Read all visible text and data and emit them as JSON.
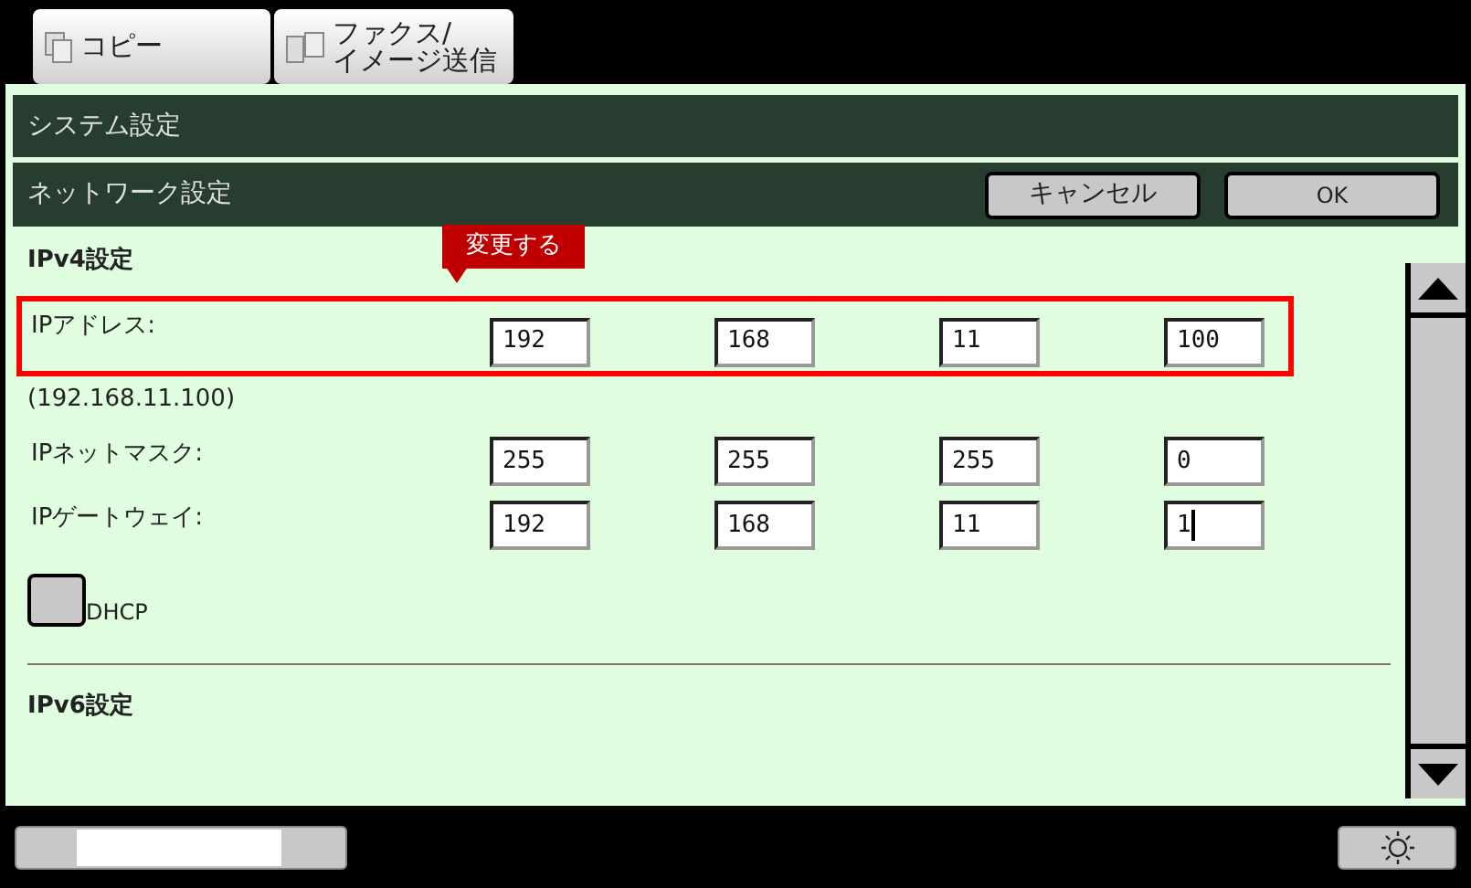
{
  "top_tabs": [
    {
      "label": "コピー",
      "kind": "copy"
    },
    {
      "label": "ファクス/\nイメージ送信",
      "kind": "fax"
    }
  ],
  "title": "システム設定",
  "subtitle": "ネットワーク設定",
  "buttons": [
    "キャンセル",
    "OK"
  ],
  "sections": [
    {
      "kind": "heading",
      "text": "IPv4設定"
    },
    {
      "kind": "address",
      "label": "IPアドレス:",
      "highlighted": true,
      "callout": "変更する",
      "octets": [
        {
          "value": "192",
          "cursor": false
        },
        {
          "value": "168",
          "cursor": false
        },
        {
          "value": "11",
          "cursor": false
        },
        {
          "value": "100",
          "cursor": false
        }
      ]
    },
    {
      "kind": "note",
      "text": "(192.168.11.100)"
    },
    {
      "kind": "address",
      "label": "IPネットマスク:",
      "highlighted": false,
      "octets": [
        {
          "value": "255",
          "cursor": false
        },
        {
          "value": "255",
          "cursor": false
        },
        {
          "value": "255",
          "cursor": false
        },
        {
          "value": "0",
          "cursor": false
        }
      ]
    },
    {
      "kind": "address",
      "label": "IPゲートウェイ:",
      "highlighted": false,
      "octets": [
        {
          "value": "192",
          "cursor": false
        },
        {
          "value": "168",
          "cursor": false
        },
        {
          "value": "11",
          "cursor": false
        },
        {
          "value": "1",
          "cursor": true
        }
      ]
    },
    {
      "kind": "checkbox",
      "label": "DHCP",
      "checked": false
    },
    {
      "kind": "divider"
    },
    {
      "kind": "heading",
      "text": "IPv6設定"
    }
  ]
}
